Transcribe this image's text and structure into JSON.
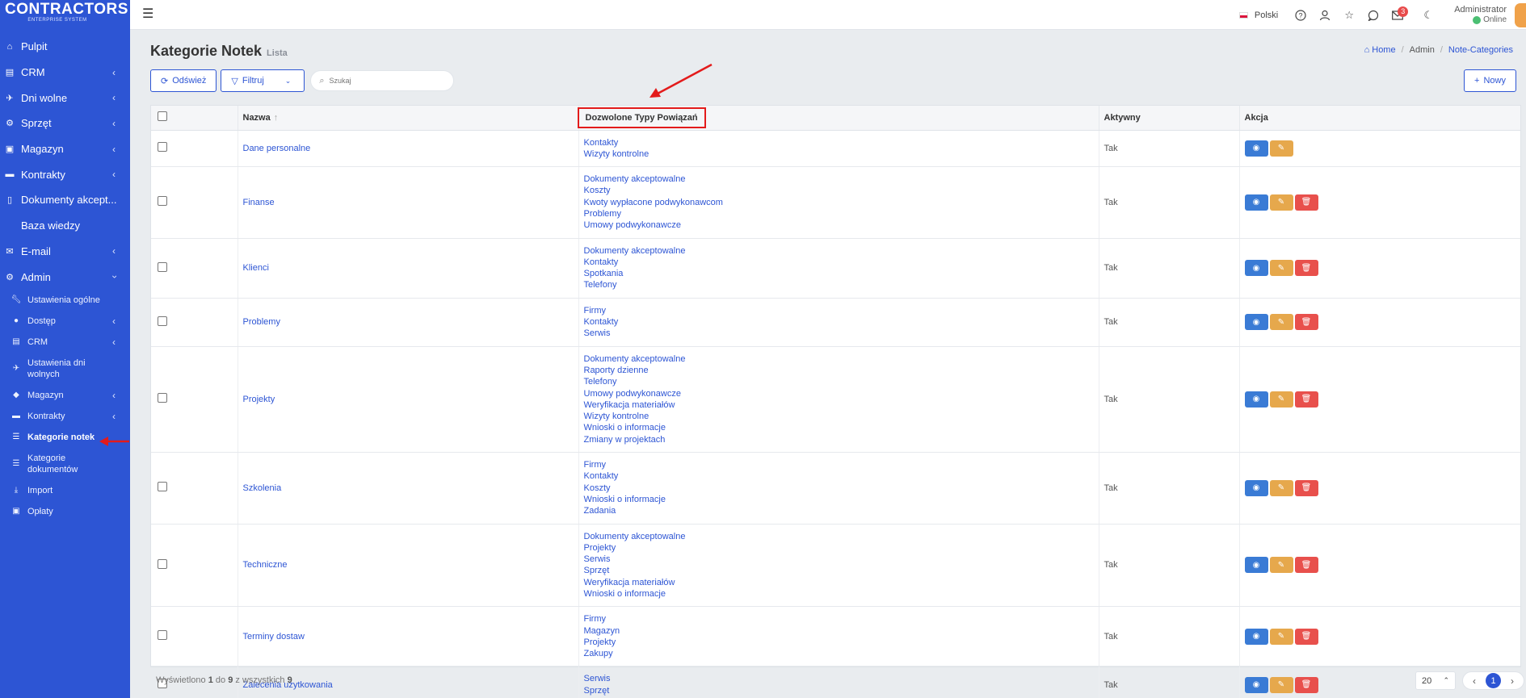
{
  "app": {
    "logo": "CONTRACTORS",
    "logo_sub": "ENTERPRISE SYSTEM"
  },
  "sidebar": {
    "items": [
      {
        "label": "Pulpit",
        "icon": "home-icon"
      },
      {
        "label": "CRM",
        "icon": "id-card-icon"
      },
      {
        "label": "Dni wolne",
        "icon": "plane-icon"
      },
      {
        "label": "Sprzęt",
        "icon": "cogs-icon"
      },
      {
        "label": "Magazyn",
        "icon": "truck-icon"
      },
      {
        "label": "Kontrakty",
        "icon": "briefcase-icon"
      },
      {
        "label": "Dokumenty akcept...",
        "icon": "file-icon"
      },
      {
        "label": "Baza wiedzy",
        "icon": "book-icon"
      },
      {
        "label": "E-mail",
        "icon": "envelope-icon"
      },
      {
        "label": "Admin",
        "icon": "admin-cogs-icon"
      }
    ],
    "admin_sub": [
      {
        "label": "Ustawienia ogólne"
      },
      {
        "label": "Dostęp"
      },
      {
        "label": "CRM"
      },
      {
        "label": "Ustawienia dni wolnych"
      },
      {
        "label": "Magazyn"
      },
      {
        "label": "Kontrakty"
      },
      {
        "label": "Kategorie notek"
      },
      {
        "label": "Kategorie dokumentów"
      },
      {
        "label": "Import"
      },
      {
        "label": "Opłaty"
      }
    ]
  },
  "topbar": {
    "language": "Polski",
    "mail_count": "3",
    "user_name": "Administrator",
    "user_status": "Online"
  },
  "page": {
    "title": "Kategorie Notek",
    "subtitle": "Lista",
    "breadcrumb": [
      "Home",
      "Admin",
      "Note-Categories"
    ]
  },
  "toolbar": {
    "refresh": "Odśwież",
    "filter": "Filtruj",
    "search_placeholder": "Szukaj",
    "new": "Nowy"
  },
  "table": {
    "headers": {
      "name": "Nazwa",
      "types": "Dozwolone Typy Powiązań",
      "active": "Aktywny",
      "action": "Akcja"
    },
    "rows": [
      {
        "name": "Dane personalne",
        "types": [
          "Kontakty",
          "Wizyty kontrolne"
        ],
        "active": "Tak",
        "can_delete": false
      },
      {
        "name": "Finanse",
        "types": [
          "Dokumenty akceptowalne",
          "Koszty",
          "Kwoty wypłacone podwykonawcom",
          "Problemy",
          "Umowy podwykonawcze"
        ],
        "active": "Tak",
        "can_delete": true
      },
      {
        "name": "Klienci",
        "types": [
          "Dokumenty akceptowalne",
          "Kontakty",
          "Spotkania",
          "Telefony"
        ],
        "active": "Tak",
        "can_delete": true
      },
      {
        "name": "Problemy",
        "types": [
          "Firmy",
          "Kontakty",
          "Serwis"
        ],
        "active": "Tak",
        "can_delete": true
      },
      {
        "name": "Projekty",
        "types": [
          "Dokumenty akceptowalne",
          "Raporty dzienne",
          "Telefony",
          "Umowy podwykonawcze",
          "Weryfikacja materiałów",
          "Wizyty kontrolne",
          "Wnioski o informacje",
          "Zmiany w projektach"
        ],
        "active": "Tak",
        "can_delete": true
      },
      {
        "name": "Szkolenia",
        "types": [
          "Firmy",
          "Kontakty",
          "Koszty",
          "Wnioski o informacje",
          "Zadania"
        ],
        "active": "Tak",
        "can_delete": true
      },
      {
        "name": "Techniczne",
        "types": [
          "Dokumenty akceptowalne",
          "Projekty",
          "Serwis",
          "Sprzęt",
          "Weryfikacja materiałów",
          "Wnioski o informacje"
        ],
        "active": "Tak",
        "can_delete": true
      },
      {
        "name": "Terminy dostaw",
        "types": [
          "Firmy",
          "Magazyn",
          "Projekty",
          "Zakupy"
        ],
        "active": "Tak",
        "can_delete": true
      },
      {
        "name": "Zalecenia użytkowania",
        "types": [
          "Serwis",
          "Sprzęt"
        ],
        "active": "Tak",
        "can_delete": true
      }
    ]
  },
  "footer": {
    "prefix": "Wyświetlono",
    "from": "1",
    "to_word": "do",
    "to": "9",
    "of_word": "z wszystkich",
    "total": "9",
    "page_size": "20",
    "current_page": "1"
  },
  "colors": {
    "sidebar": "#2d55d4",
    "accent": "#2d55d4",
    "view": "#3a7bd5",
    "edit": "#e6a84c",
    "delete": "#e8504c",
    "annotation": "#e31b1b"
  }
}
